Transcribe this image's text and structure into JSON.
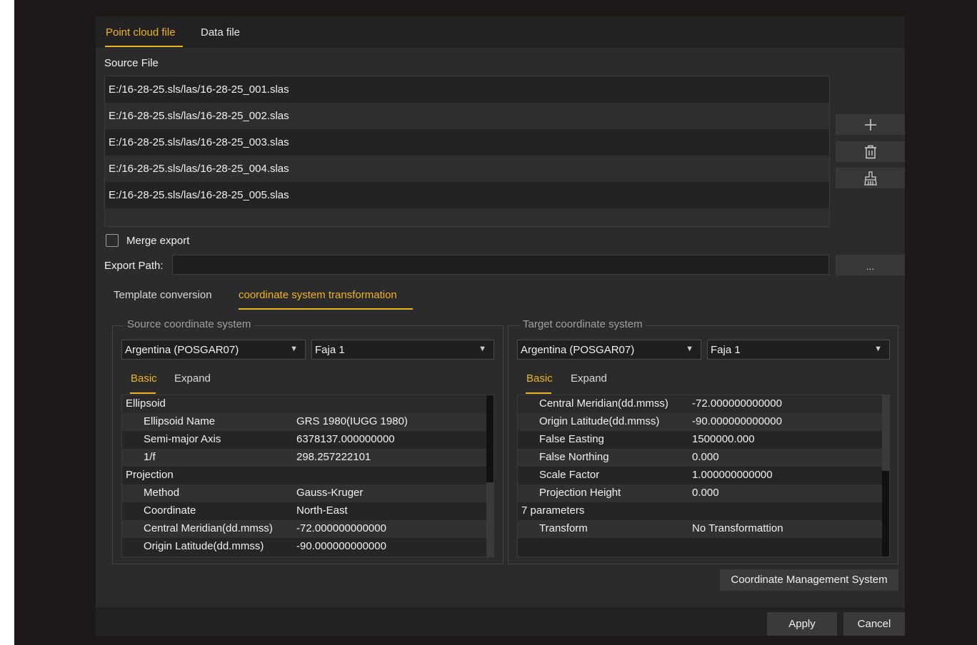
{
  "tabs_top": [
    {
      "label": "Point cloud file",
      "active": true
    },
    {
      "label": "Data file",
      "active": false
    }
  ],
  "source_file_label": "Source File",
  "files": [
    "E:/16-28-25.sls/las/16-28-25_001.slas",
    "E:/16-28-25.sls/las/16-28-25_002.slas",
    "E:/16-28-25.sls/las/16-28-25_003.slas",
    "E:/16-28-25.sls/las/16-28-25_004.slas",
    "E:/16-28-25.sls/las/16-28-25_005.slas"
  ],
  "side_buttons": {
    "add": "+",
    "delete": "trash-icon",
    "clear": "broom-icon"
  },
  "merge_export": {
    "label": "Merge export",
    "checked": false
  },
  "export_path": {
    "label": "Export Path:",
    "value": "",
    "browse": "..."
  },
  "mode_tabs": [
    {
      "label": "Template conversion",
      "active": false
    },
    {
      "label": "coordinate system transformation",
      "active": true
    }
  ],
  "source": {
    "title": "Source coordinate system",
    "country": "Argentina (POSGAR07)",
    "zone": "Faja 1",
    "tabs": [
      "Basic",
      "Expand"
    ],
    "rows": [
      {
        "name": "Ellipsoid",
        "value": "",
        "group": true
      },
      {
        "name": "Ellipsoid Name",
        "value": "GRS 1980(IUGG 1980)"
      },
      {
        "name": "Semi-major Axis",
        "value": "6378137.000000000"
      },
      {
        "name": "1/f",
        "value": "298.257222101"
      },
      {
        "name": "Projection",
        "value": "",
        "group": true
      },
      {
        "name": "Method",
        "value": "Gauss-Kruger"
      },
      {
        "name": "Coordinate",
        "value": "North-East"
      },
      {
        "name": "Central Meridian(dd.mmss)",
        "value": "-72.000000000000"
      },
      {
        "name": "Origin Latitude(dd.mmss)",
        "value": "-90.000000000000"
      }
    ]
  },
  "target": {
    "title": "Target coordinate system",
    "country": "Argentina (POSGAR07)",
    "zone": "Faja 1",
    "tabs": [
      "Basic",
      "Expand"
    ],
    "rows": [
      {
        "name": "Central Meridian(dd.mmss)",
        "value": "-72.000000000000"
      },
      {
        "name": "Origin Latitude(dd.mmss)",
        "value": "-90.000000000000"
      },
      {
        "name": "False Easting",
        "value": "1500000.000"
      },
      {
        "name": "False Northing",
        "value": "0.000"
      },
      {
        "name": "Scale Factor",
        "value": "1.000000000000"
      },
      {
        "name": "Projection Height",
        "value": "0.000"
      },
      {
        "name": "7 parameters",
        "value": "",
        "group": true
      },
      {
        "name": "Transform",
        "value": "No Transformattion"
      }
    ]
  },
  "coord_mgmt_button": "Coordinate Management System",
  "apply_button": "Apply",
  "cancel_button": "Cancel",
  "colors": {
    "accent": "#f0b323",
    "panel": "#2b2b2b",
    "dark": "#202020"
  }
}
